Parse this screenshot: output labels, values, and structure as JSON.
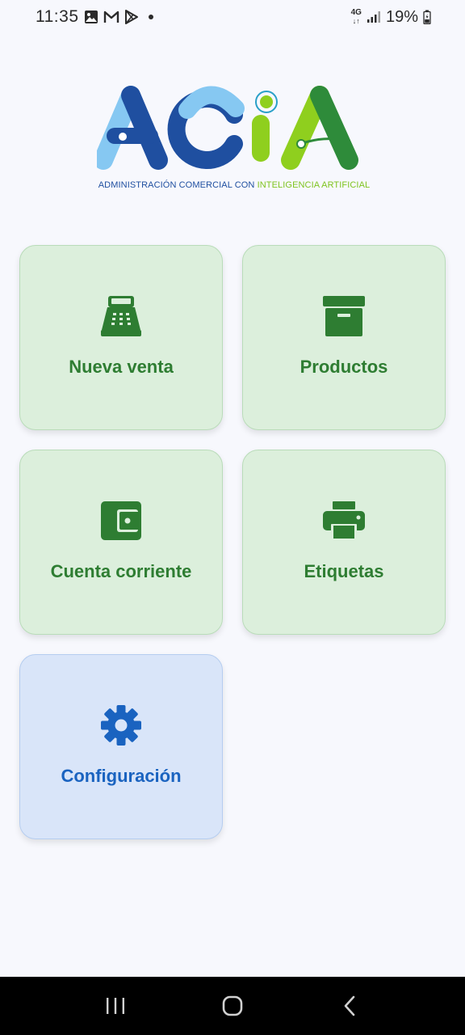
{
  "status_bar": {
    "time": "11:35",
    "network_type": "4G",
    "battery_percent": "19%",
    "icons": [
      "gallery-icon",
      "gmail-icon",
      "play-store-icon",
      "notification-dot",
      "signal-icon",
      "battery-icon"
    ]
  },
  "logo": {
    "wordmark": "ACIA",
    "subtitle_part1": "ADMINISTRACIÓN COMERCIAL CON ",
    "subtitle_part2": "INTELIGENCIA ARTIFICIAL",
    "colors": {
      "blue": "#1f4fa0",
      "light_blue": "#86c8f2",
      "green": "#2e8b3a",
      "lime": "#8fcf1e"
    }
  },
  "menu": {
    "items": [
      {
        "label": "Nueva venta",
        "icon": "cash-register-icon"
      },
      {
        "label": "Productos",
        "icon": "archive-box-icon"
      },
      {
        "label": "Cuenta corriente",
        "icon": "wallet-icon"
      },
      {
        "label": "Etiquetas",
        "icon": "printer-icon"
      },
      {
        "label": "Configuración",
        "icon": "gear-icon"
      }
    ]
  },
  "theme": {
    "tile_green_bg": "#dcefdc",
    "tile_green_fg": "#2e7d32",
    "tile_blue_bg": "#d9e5f9",
    "tile_blue_fg": "#1a63c0"
  },
  "nav_bar": {
    "buttons": [
      "recent-apps",
      "home",
      "back"
    ]
  }
}
